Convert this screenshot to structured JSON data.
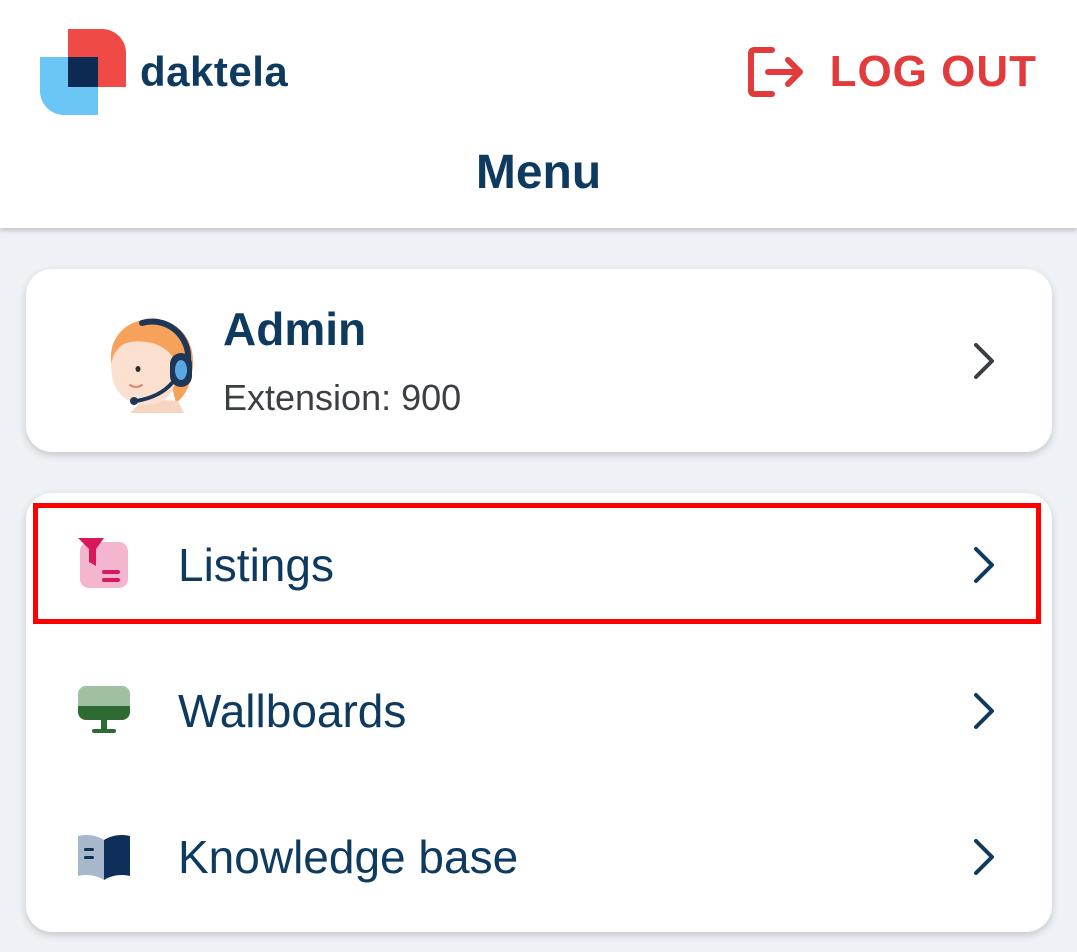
{
  "app": {
    "brand_name": "daktela",
    "logout_label": "LOG OUT",
    "page_title": "Menu"
  },
  "profile": {
    "name": "Admin",
    "extension": "Extension: 900"
  },
  "menu": {
    "items": [
      {
        "label": "Listings",
        "icon": "listings-filter-icon"
      },
      {
        "label": "Wallboards",
        "icon": "wallboard-monitor-icon"
      },
      {
        "label": "Knowledge base",
        "icon": "knowledge-book-icon"
      }
    ]
  },
  "colors": {
    "primary_text": "#0e3a5f",
    "logout_red": "#e23b3b",
    "background": "#eef2f6",
    "highlight": "#ff0000"
  }
}
